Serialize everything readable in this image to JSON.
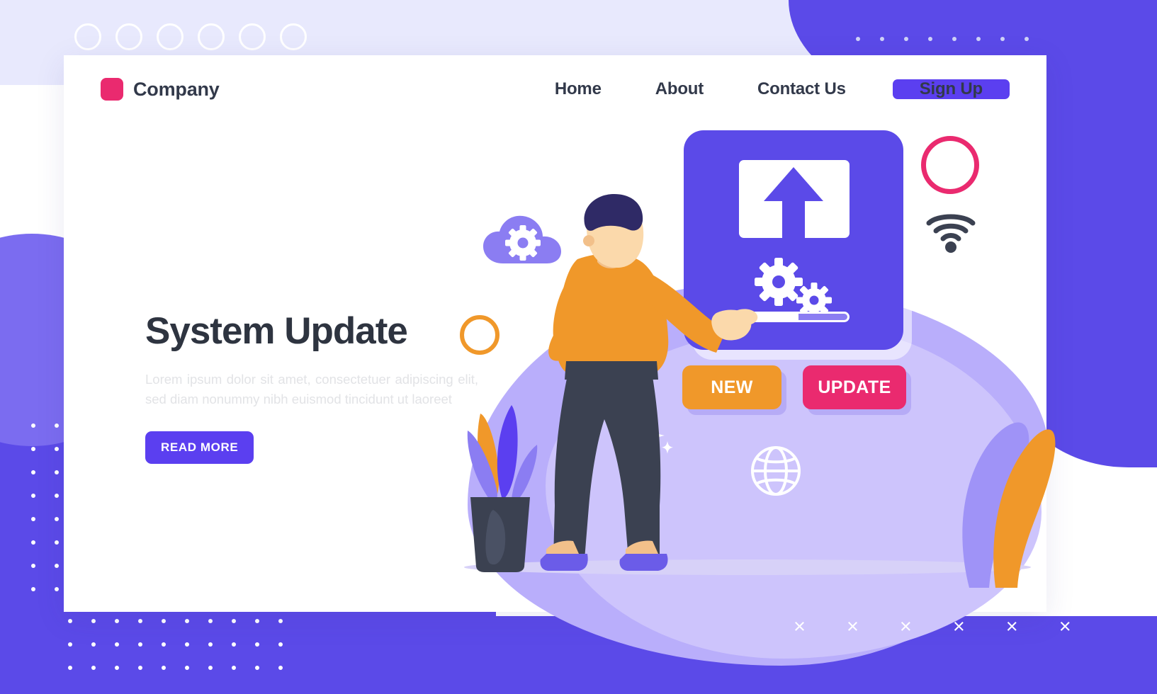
{
  "window": {
    "dots_count": 6
  },
  "nav": {
    "brand": "Company",
    "brand_color": "#ea2a6f",
    "links": [
      {
        "label": "Home"
      },
      {
        "label": "About"
      },
      {
        "label": "Contact Us"
      }
    ],
    "signup_label": "Sign Up",
    "signup_color": "#5b3ff0"
  },
  "hero": {
    "title": "System Update",
    "body": "Lorem ipsum dolor sit amet, consectetuer adipiscing elit, sed diam nonummy nibh euismod tincidunt ut laoreet",
    "cta_label": "READ MORE",
    "cta_color": "#5b3ff0",
    "title_color": "#2e3440"
  },
  "illustration": {
    "card": {
      "color": "#5b4ae8",
      "upload_icon": "upload-arrow-icon",
      "gears_icon": "gears-icon",
      "progress_percent": 54
    },
    "buttons": [
      {
        "label": "NEW",
        "color": "#f0982a"
      },
      {
        "label": "UPDATE",
        "color": "#ea2a6f"
      }
    ],
    "icons": [
      "cloud-settings-icon",
      "wifi-icon",
      "globe-icon",
      "sparkle-icon",
      "circle-outline-pink",
      "circle-outline-orange",
      "plant-icon",
      "leaves-icon",
      "person-illustration"
    ]
  },
  "decorations": {
    "x_marks": [
      "×",
      "×",
      "×",
      "×",
      "×",
      "×"
    ],
    "accent_purple": "#5b4ae8",
    "accent_lavender": "#e8e9fd",
    "accent_pink": "#ea2a6f",
    "accent_orange": "#f0982a"
  }
}
